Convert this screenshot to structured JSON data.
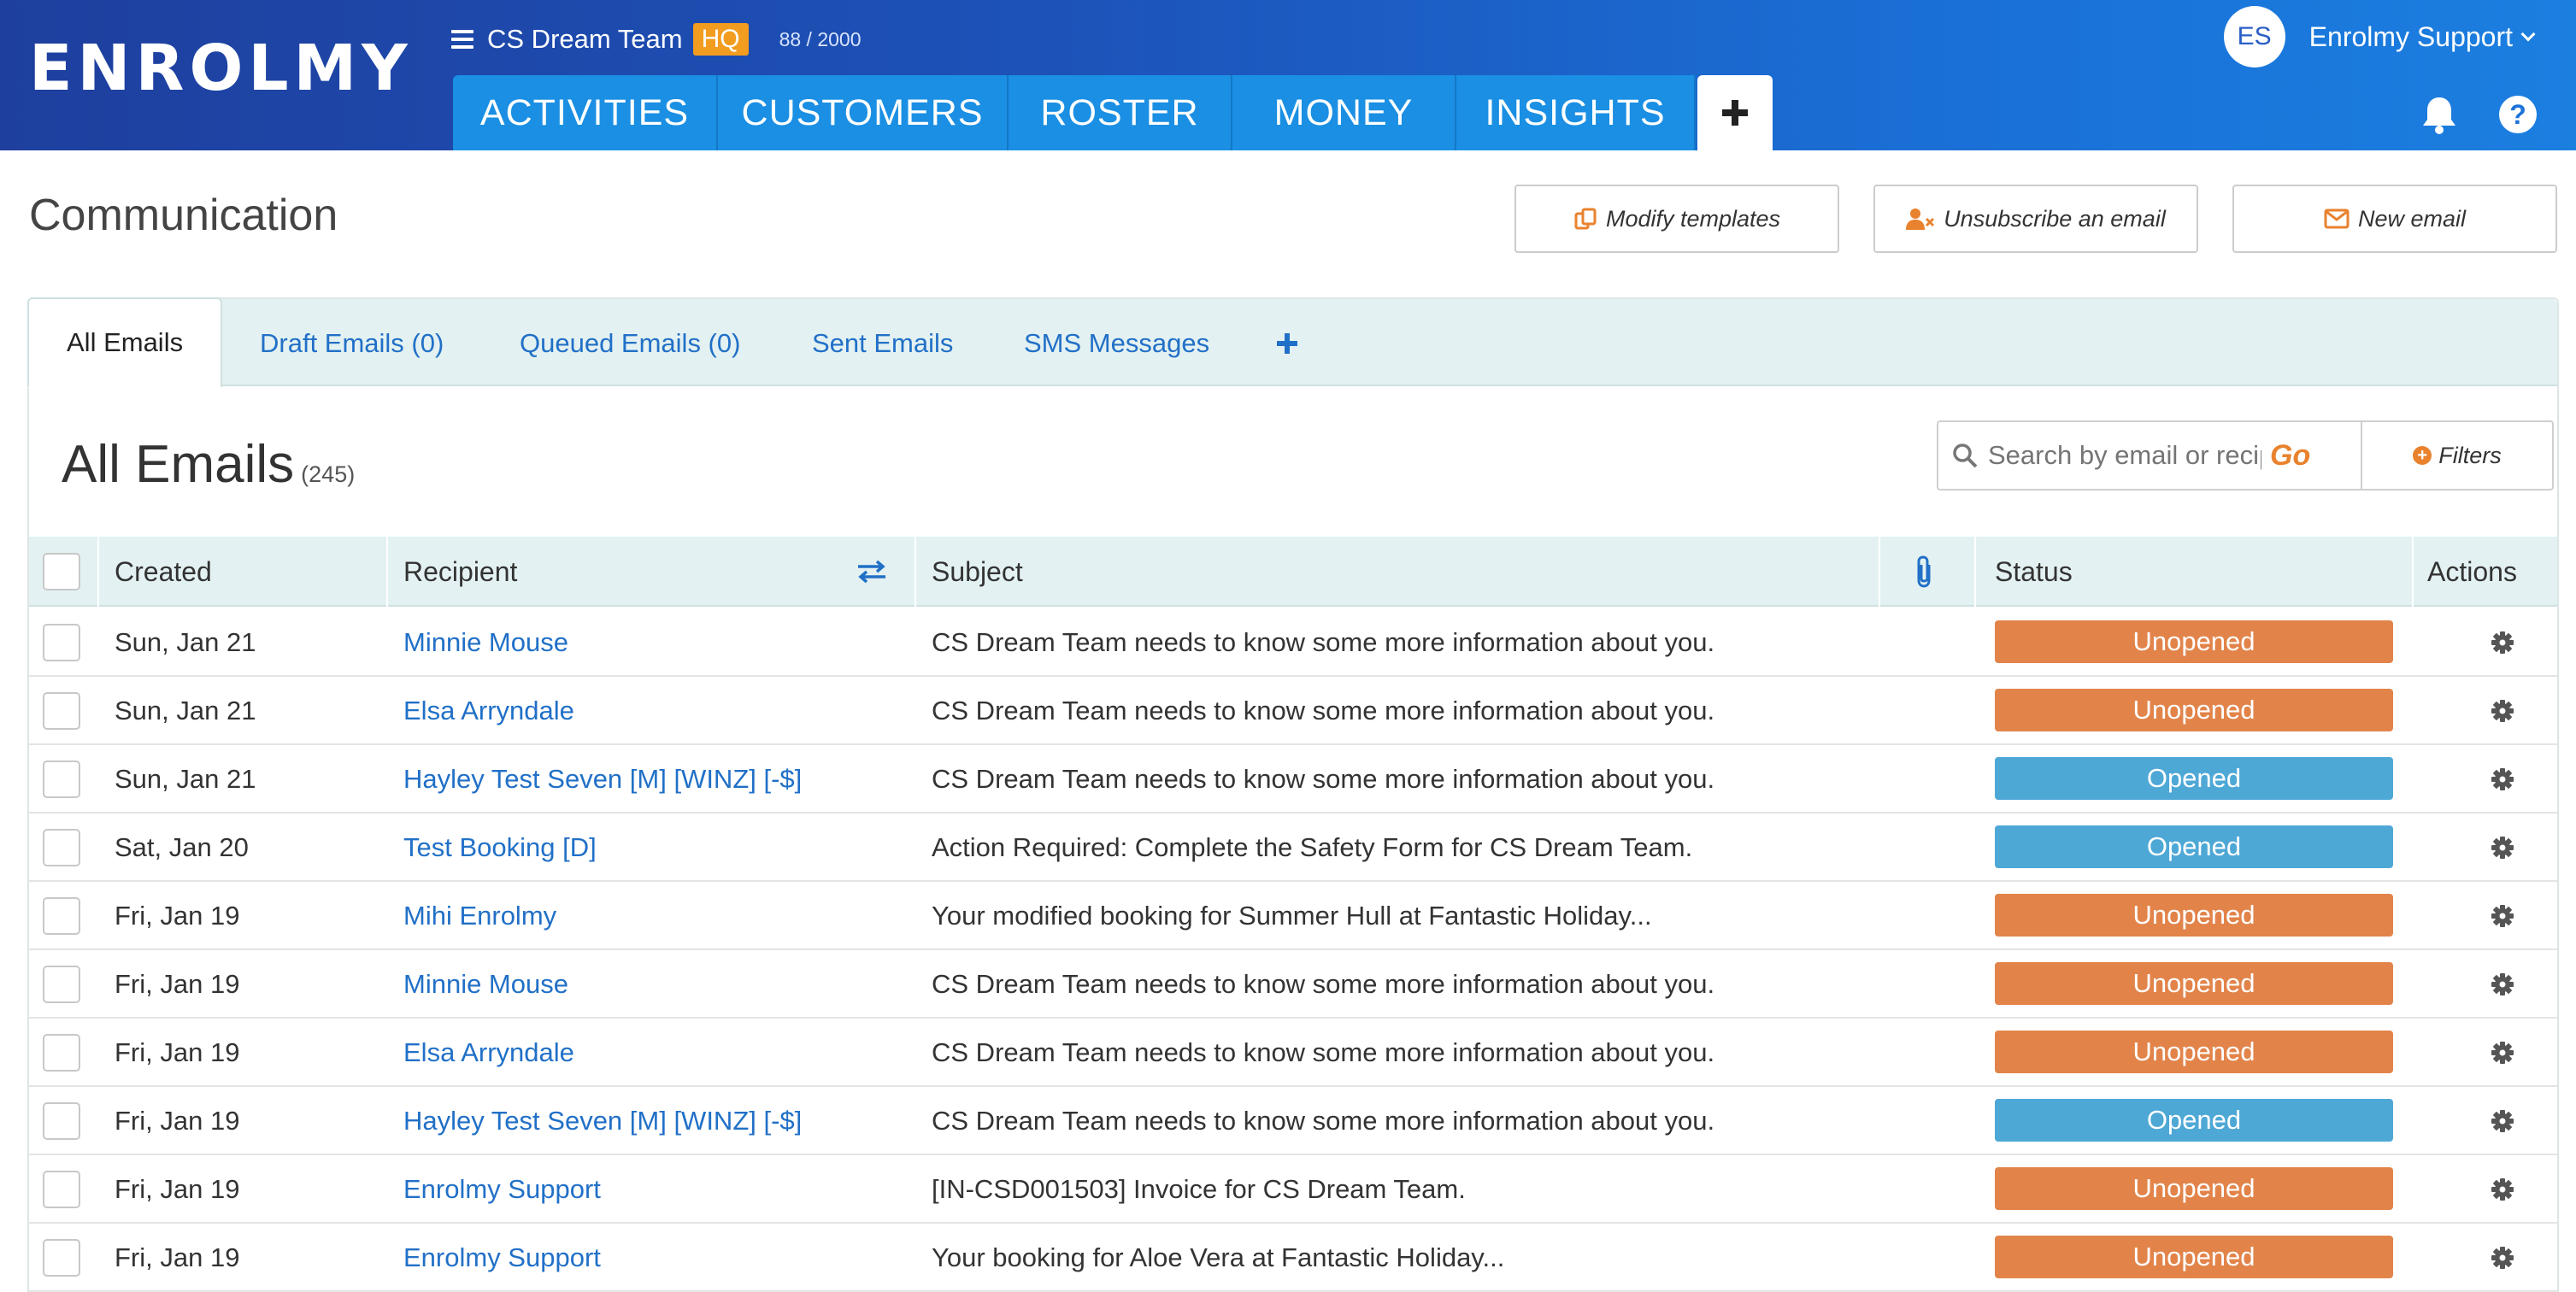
{
  "header": {
    "logo": "ENROLMY",
    "team_name": "CS Dream Team",
    "hq_badge": "HQ",
    "team_count": "88 / 2000",
    "user_initials": "ES",
    "user_name": "Enrolmy Support",
    "nav": [
      "ACTIVITIES",
      "CUSTOMERS",
      "ROSTER",
      "MONEY",
      "INSIGHTS"
    ]
  },
  "page": {
    "title": "Communication",
    "buttons": {
      "modify_templates": "Modify templates",
      "unsubscribe": "Unsubscribe an email",
      "new_email": "New email"
    }
  },
  "tabs": [
    "All Emails",
    "Draft Emails (0)",
    "Queued Emails (0)",
    "Sent Emails",
    "SMS Messages"
  ],
  "list": {
    "title": "All Emails",
    "count": "(245)",
    "search_placeholder": "Search by email or recipient",
    "go_label": "Go",
    "filters_label": "Filters"
  },
  "table": {
    "headers": {
      "created": "Created",
      "recipient": "Recipient",
      "subject": "Subject",
      "status": "Status",
      "actions": "Actions"
    },
    "rows": [
      {
        "created": "Sun, Jan 21",
        "recipient": "Minnie Mouse",
        "subject": "CS Dream Team needs to know some more information about you.",
        "status": "Unopened"
      },
      {
        "created": "Sun, Jan 21",
        "recipient": "Elsa Arryndale",
        "subject": "CS Dream Team needs to know some more information about you.",
        "status": "Unopened"
      },
      {
        "created": "Sun, Jan 21",
        "recipient": "Hayley Test Seven [M] [WINZ] [-$]",
        "subject": "CS Dream Team needs to know some more information about you.",
        "status": "Opened"
      },
      {
        "created": "Sat, Jan 20",
        "recipient": "Test Booking [D]",
        "subject": "Action Required: Complete the Safety Form for CS Dream Team.",
        "status": "Opened"
      },
      {
        "created": "Fri, Jan 19",
        "recipient": "Mihi Enrolmy",
        "subject": "Your modified booking for Summer Hull at Fantastic Holiday...",
        "status": "Unopened"
      },
      {
        "created": "Fri, Jan 19",
        "recipient": "Minnie Mouse",
        "subject": "CS Dream Team needs to know some more information about you.",
        "status": "Unopened"
      },
      {
        "created": "Fri, Jan 19",
        "recipient": "Elsa Arryndale",
        "subject": "CS Dream Team needs to know some more information about you.",
        "status": "Unopened"
      },
      {
        "created": "Fri, Jan 19",
        "recipient": "Hayley Test Seven [M] [WINZ] [-$]",
        "subject": "CS Dream Team needs to know some more information about you.",
        "status": "Opened"
      },
      {
        "created": "Fri, Jan 19",
        "recipient": "Enrolmy Support",
        "subject": "[IN-CSD001503] Invoice for CS Dream Team.",
        "status": "Unopened"
      },
      {
        "created": "Fri, Jan 19",
        "recipient": "Enrolmy Support",
        "subject": "Your booking for Aloe Vera at Fantastic Holiday...",
        "status": "Unopened"
      }
    ]
  },
  "colors": {
    "unopened": "#e2844a",
    "opened": "#4ea8d6",
    "link": "#2170c7",
    "accent_orange": "#e9822e",
    "nav_tab": "#1a8fe3"
  },
  "icons": {
    "menu": "hamburger-icon",
    "add_tab": "plus-icon",
    "bell": "bell-icon",
    "help": "help-icon",
    "search": "search-icon",
    "sort": "swap-icon",
    "attachment": "paperclip-icon",
    "row_action": "gear-icon"
  }
}
